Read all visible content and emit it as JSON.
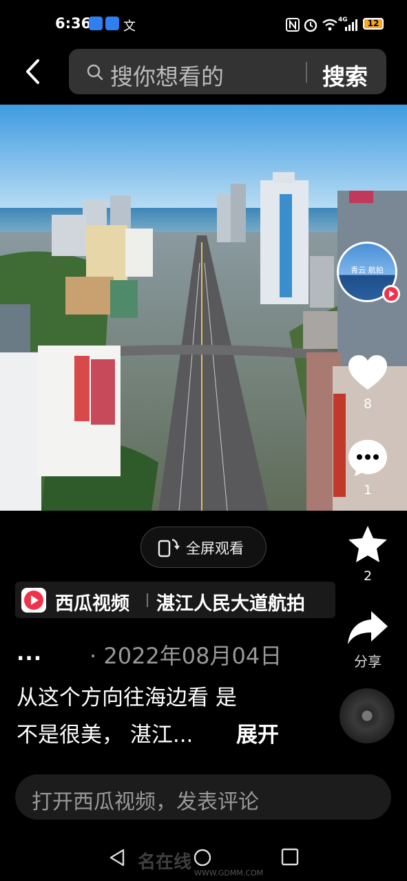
{
  "status": {
    "time": "6:36",
    "battery": "12",
    "network": "4G",
    "mini_icon_text": "文"
  },
  "search": {
    "placeholder": "搜你想看的",
    "button": "搜索"
  },
  "video": {
    "fullscreen_label": "全屏观看",
    "avatar_text": "青云 航拍"
  },
  "actions": {
    "like_count": "8",
    "comment_count": "1",
    "favorite_count": "2",
    "share_label": "分享"
  },
  "source": {
    "app_name": "西瓜视频",
    "title": "湛江人民大道航拍"
  },
  "meta": {
    "dots": "...",
    "date": "· 2022年08月04日"
  },
  "description": {
    "line1": "从这个方向往海边看 是",
    "line2": "不是很美，  湛江...",
    "expand": "展开"
  },
  "comment": {
    "placeholder": "打开西瓜视频，发表评论"
  },
  "watermark": {
    "text": "名在线",
    "url": "WWW.GDMM.COM"
  },
  "colors": {
    "accent_red": "#f0334a",
    "battery": "#f5a623",
    "surface": "#1c1c1c"
  }
}
